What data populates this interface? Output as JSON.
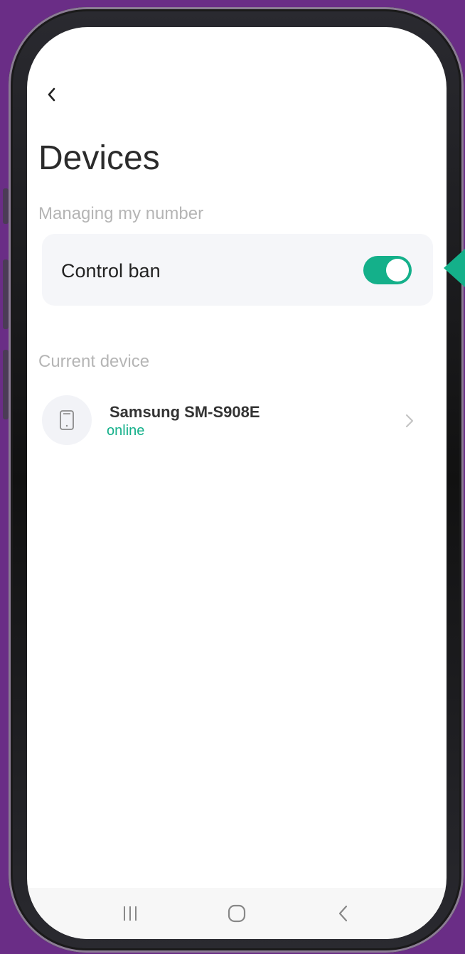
{
  "header": {
    "title": "Devices"
  },
  "sections": {
    "managing_label": "Managing my number",
    "current_label": "Current device"
  },
  "control_ban": {
    "label": "Control ban",
    "enabled": true
  },
  "device": {
    "name": "Samsung SM-S908E",
    "status": "online"
  },
  "icons": {
    "back": "chevron-left-icon",
    "phone": "phone-icon",
    "chevron": "chevron-right-icon",
    "recents": "recents-icon",
    "home": "home-icon",
    "nav_back": "back-icon"
  },
  "colors": {
    "accent": "#14b08a",
    "background": "#6a2d86"
  }
}
